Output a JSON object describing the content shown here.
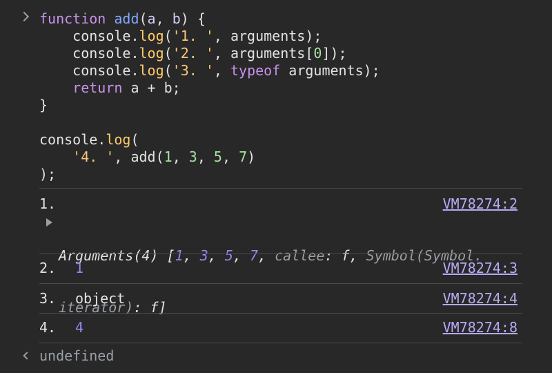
{
  "input": {
    "lines": [
      [
        {
          "t": "function",
          "c": "kw"
        },
        {
          "t": " "
        },
        {
          "t": "add",
          "c": "fn"
        },
        {
          "t": "("
        },
        {
          "t": "a",
          "c": "param"
        },
        {
          "t": ", "
        },
        {
          "t": "b",
          "c": "param"
        },
        {
          "t": ") {"
        }
      ],
      [
        {
          "t": "    console."
        },
        {
          "t": "log",
          "c": "method"
        },
        {
          "t": "("
        },
        {
          "t": "'1. '",
          "c": "str"
        },
        {
          "t": ", arguments);"
        }
      ],
      [
        {
          "t": "    console."
        },
        {
          "t": "log",
          "c": "method"
        },
        {
          "t": "("
        },
        {
          "t": "'2. '",
          "c": "str"
        },
        {
          "t": ", arguments["
        },
        {
          "t": "0",
          "c": "num"
        },
        {
          "t": "]);"
        }
      ],
      [
        {
          "t": "    console."
        },
        {
          "t": "log",
          "c": "method"
        },
        {
          "t": "("
        },
        {
          "t": "'3. '",
          "c": "str"
        },
        {
          "t": ", "
        },
        {
          "t": "typeof",
          "c": "typeof-kw"
        },
        {
          "t": " arguments);"
        }
      ],
      [
        {
          "t": "    "
        },
        {
          "t": "return",
          "c": "kw"
        },
        {
          "t": " a + b;"
        }
      ],
      [
        {
          "t": "}"
        }
      ],
      [
        {
          "t": ""
        }
      ],
      [
        {
          "t": "console."
        },
        {
          "t": "log",
          "c": "method"
        },
        {
          "t": "("
        }
      ],
      [
        {
          "t": "    "
        },
        {
          "t": "'4. '",
          "c": "str"
        },
        {
          "t": ", add("
        },
        {
          "t": "1",
          "c": "num"
        },
        {
          "t": ", "
        },
        {
          "t": "3",
          "c": "num"
        },
        {
          "t": ", "
        },
        {
          "t": "5",
          "c": "num"
        },
        {
          "t": ", "
        },
        {
          "t": "7",
          "c": "num"
        },
        {
          "t": ")"
        }
      ],
      [
        {
          "t": ");"
        }
      ]
    ]
  },
  "logs": {
    "log1": {
      "index": "1.",
      "source": "VM78274:2",
      "args_line1": [
        {
          "t": "Arguments(4) [",
          "c": "args-label"
        },
        {
          "t": "1",
          "c": "args-num"
        },
        {
          "t": ", ",
          "c": "args-label"
        },
        {
          "t": "3",
          "c": "args-num"
        },
        {
          "t": ", ",
          "c": "args-label"
        },
        {
          "t": "5",
          "c": "args-num"
        },
        {
          "t": ", ",
          "c": "args-label"
        },
        {
          "t": "7",
          "c": "args-num"
        },
        {
          "t": ", ",
          "c": "args-label"
        },
        {
          "t": "callee",
          "c": "args-key"
        },
        {
          "t": ": ",
          "c": "args-label"
        },
        {
          "t": "f",
          "c": "args-f"
        },
        {
          "t": ", ",
          "c": "args-label"
        },
        {
          "t": "Symbol(Symbol.",
          "c": "args-key"
        }
      ],
      "args_line2": [
        {
          "t": "iterator)",
          "c": "args-key"
        },
        {
          "t": ": ",
          "c": "args-label"
        },
        {
          "t": "f",
          "c": "args-f"
        },
        {
          "t": "]",
          "c": "args-label"
        }
      ]
    },
    "log2": {
      "index": "2.",
      "value": "1",
      "source": "VM78274:3"
    },
    "log3": {
      "index": "3.",
      "value": "object",
      "source": "VM78274:4"
    },
    "log4": {
      "index": "4.",
      "value": "4",
      "source": "VM78274:8"
    }
  },
  "result": {
    "text": "undefined"
  },
  "colors": {
    "background": "#282828",
    "keyword": "#c792ea",
    "function_name": "#82aaff",
    "string": "#f9c87a",
    "number": "#a6e3a1",
    "log_number": "#8d8cf2",
    "link": "#b8a9f5",
    "muted": "#9aa0a6"
  },
  "icons": {
    "prompt": "input-prompt-chevron-icon",
    "expand": "expand-triangle-icon",
    "result": "result-return-arrow-icon"
  }
}
